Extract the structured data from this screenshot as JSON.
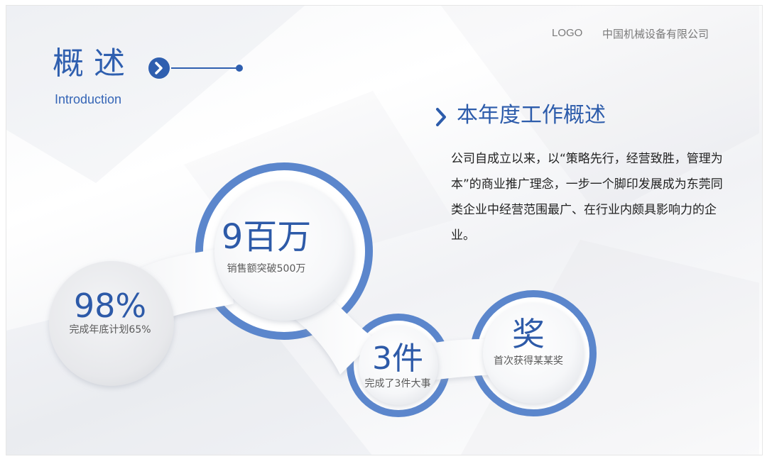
{
  "header": {
    "logo": "LOGO",
    "company": "中国机械设备有限公司"
  },
  "section": {
    "title": "概述",
    "subtitle": "Introduction"
  },
  "overview": {
    "heading": "本年度工作概述",
    "body": "公司自成立以来，以“策略先行，经营致胜，管理为本”的商业推广理念，一步一个脚印发展成为东莞同类企业中经营范围最广、在行业内颇具影响力的企业。"
  },
  "stats": [
    {
      "value": "9百万",
      "label": "销售额突破500万"
    },
    {
      "value": "98%",
      "label": "完成年底计划65%"
    },
    {
      "value": "3件",
      "label": "完成了3件大事"
    },
    {
      "value": "奖",
      "label": "首次获得某某奖"
    }
  ],
  "colors": {
    "accent": "#2f5faf",
    "ring": "#5b86cc",
    "text": "#222222",
    "muted": "#5a5a5a"
  }
}
